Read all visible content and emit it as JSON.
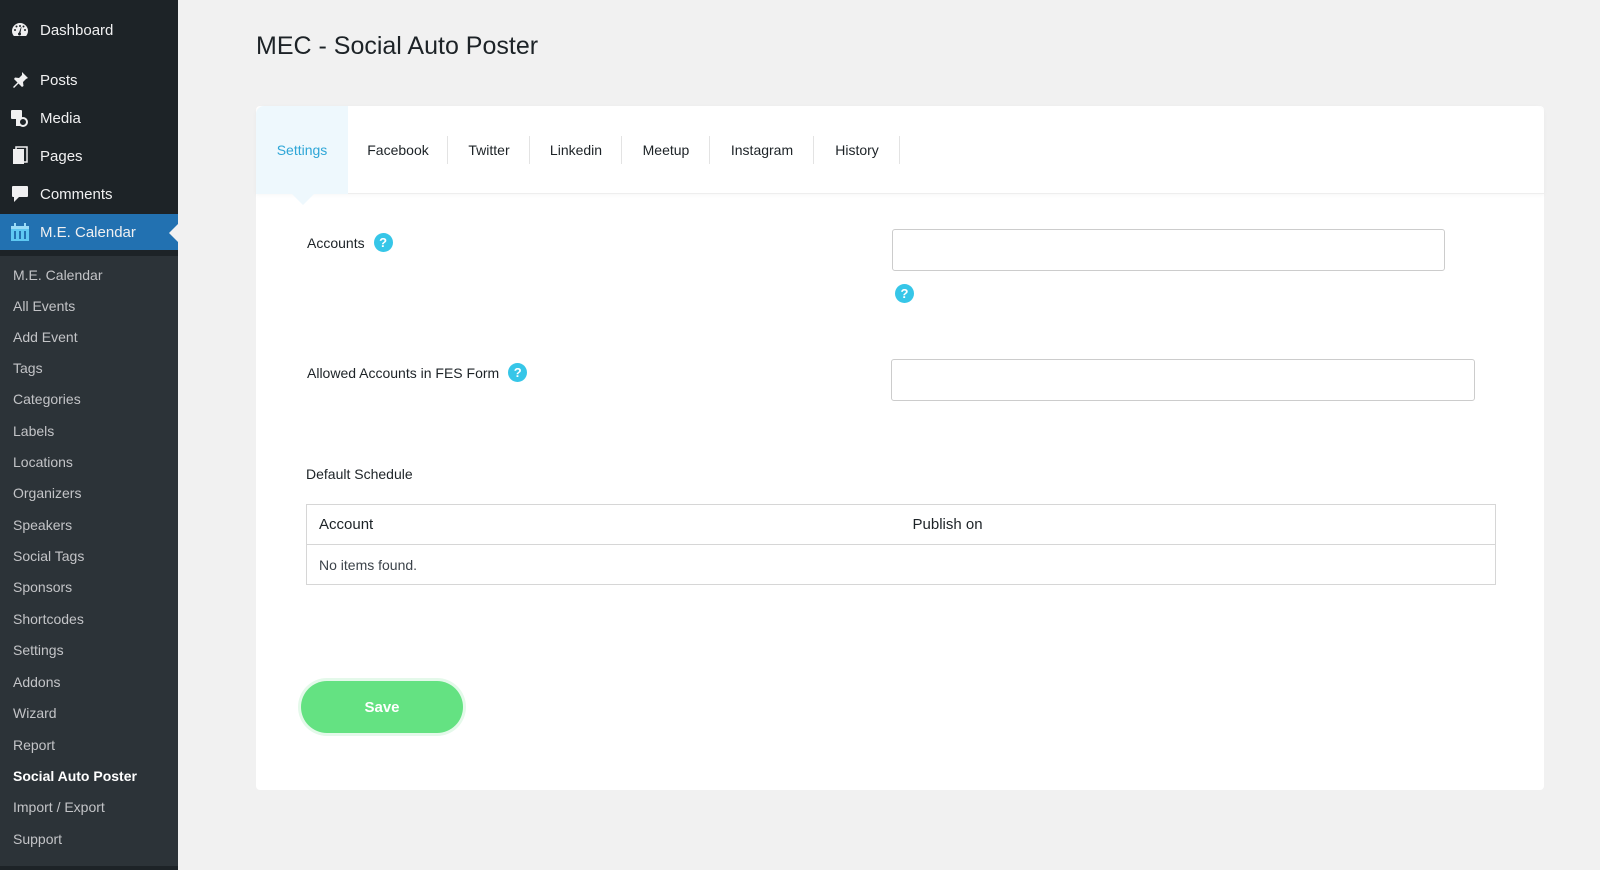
{
  "sidebar": {
    "top_items": [
      {
        "label": "Dashboard",
        "icon": "dashboard-icon"
      },
      {
        "label": "Posts",
        "icon": "pin-icon"
      },
      {
        "label": "Media",
        "icon": "media-icon"
      },
      {
        "label": "Pages",
        "icon": "pages-icon"
      },
      {
        "label": "Comments",
        "icon": "comment-icon"
      },
      {
        "label": "M.E. Calendar",
        "icon": "calendar-icon"
      }
    ],
    "submenu": [
      "M.E. Calendar",
      "All Events",
      "Add Event",
      "Tags",
      "Categories",
      "Labels",
      "Locations",
      "Organizers",
      "Speakers",
      "Social Tags",
      "Sponsors",
      "Shortcodes",
      "Settings",
      "Addons",
      "Wizard",
      "Report",
      "Social Auto Poster",
      "Import / Export",
      "Support"
    ],
    "current_submenu": "Social Auto Poster"
  },
  "page": {
    "title": "MEC - Social Auto Poster"
  },
  "tabs": [
    "Settings",
    "Facebook",
    "Twitter",
    "Linkedin",
    "Meetup",
    "Instagram",
    "History"
  ],
  "active_tab": "Settings",
  "form": {
    "accounts_label": "Accounts",
    "accounts_value": "",
    "allowed_label": "Allowed Accounts in FES Form",
    "allowed_value": "",
    "help_glyph": "?"
  },
  "schedule": {
    "title": "Default Schedule",
    "columns": [
      "Account",
      "Publish on"
    ],
    "empty_text": "No items found."
  },
  "save_label": "Save",
  "colors": {
    "sidebar_bg": "#1d2327",
    "submenu_bg": "#2c3338",
    "active_menu": "#2271b1",
    "tab_active_text": "#2ea6d7",
    "help_icon": "#36c6e8",
    "save_button": "#64e282"
  }
}
